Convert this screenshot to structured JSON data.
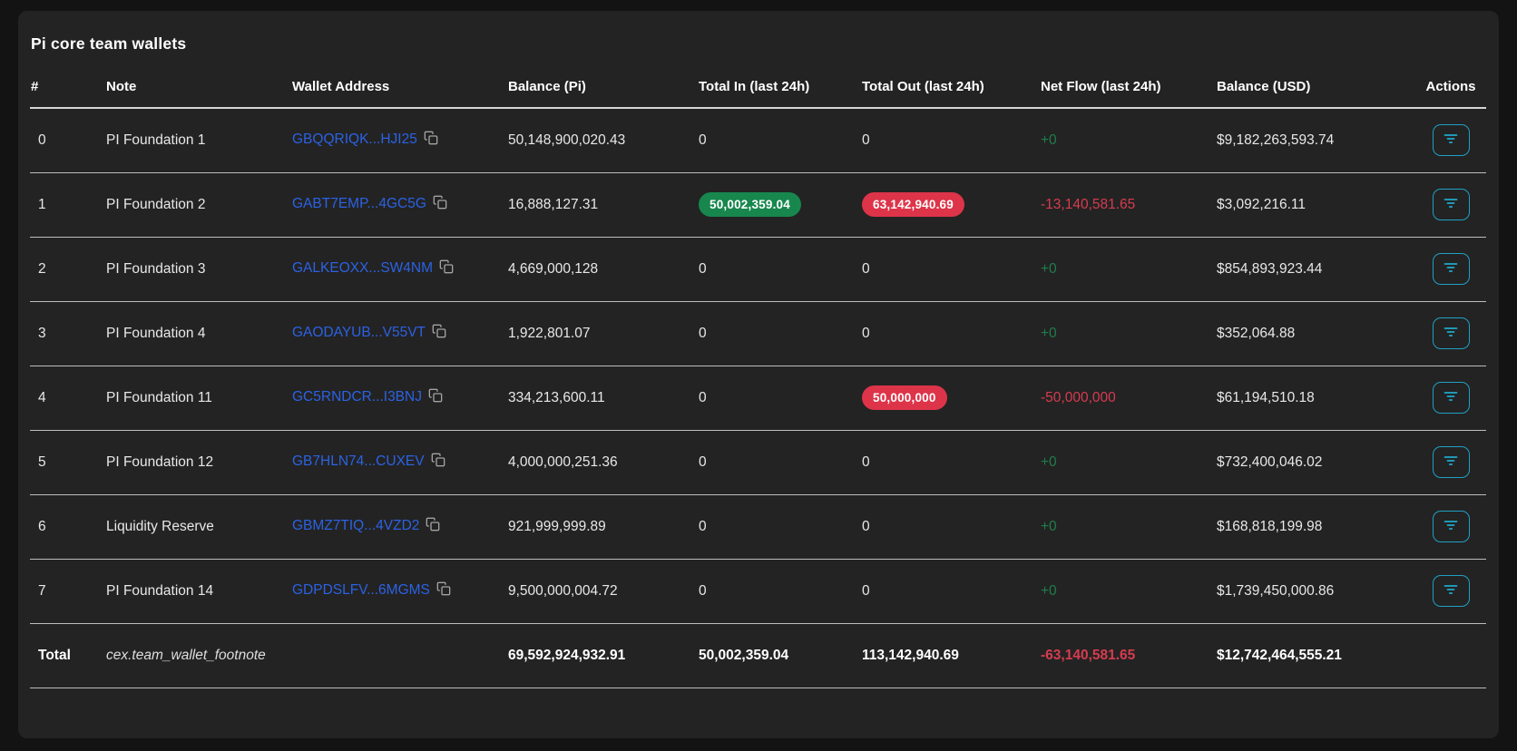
{
  "title": "Pi core team wallets",
  "columns": {
    "num": "#",
    "note": "Note",
    "wallet": "Wallet Address",
    "balance_pi": "Balance (Pi)",
    "total_in": "Total In (last 24h)",
    "total_out": "Total Out (last 24h)",
    "net_flow": "Net Flow (last 24h)",
    "balance_usd": "Balance (USD)",
    "actions": "Actions"
  },
  "rows": [
    {
      "num": "0",
      "note": "PI Foundation 1",
      "wallet": "GBQQRIQK...HJI25",
      "balance_pi": "50,148,900,020.43",
      "total_in": "0",
      "total_out": "0",
      "net_flow": "+0",
      "balance_usd": "$9,182,263,593.74"
    },
    {
      "num": "1",
      "note": "PI Foundation 2",
      "wallet": "GABT7EMP...4GC5G",
      "balance_pi": "16,888,127.31",
      "total_in": "50,002,359.04",
      "total_out": "63,142,940.69",
      "net_flow": "-13,140,581.65",
      "balance_usd": "$3,092,216.11"
    },
    {
      "num": "2",
      "note": "PI Foundation 3",
      "wallet": "GALKEOXX...SW4NM",
      "balance_pi": "4,669,000,128",
      "total_in": "0",
      "total_out": "0",
      "net_flow": "+0",
      "balance_usd": "$854,893,923.44"
    },
    {
      "num": "3",
      "note": "PI Foundation 4",
      "wallet": "GAODAYUB...V55VT",
      "balance_pi": "1,922,801.07",
      "total_in": "0",
      "total_out": "0",
      "net_flow": "+0",
      "balance_usd": "$352,064.88"
    },
    {
      "num": "4",
      "note": "PI Foundation 11",
      "wallet": "GC5RNDCR...I3BNJ",
      "balance_pi": "334,213,600.11",
      "total_in": "0",
      "total_out": "50,000,000",
      "net_flow": "-50,000,000",
      "balance_usd": "$61,194,510.18"
    },
    {
      "num": "5",
      "note": "PI Foundation 12",
      "wallet": "GB7HLN74...CUXEV",
      "balance_pi": "4,000,000,251.36",
      "total_in": "0",
      "total_out": "0",
      "net_flow": "+0",
      "balance_usd": "$732,400,046.02"
    },
    {
      "num": "6",
      "note": "Liquidity Reserve",
      "wallet": "GBMZ7TIQ...4VZD2",
      "balance_pi": "921,999,999.89",
      "total_in": "0",
      "total_out": "0",
      "net_flow": "+0",
      "balance_usd": "$168,818,199.98"
    },
    {
      "num": "7",
      "note": "PI Foundation 14",
      "wallet": "GDPDSLFV...6MGMS",
      "balance_pi": "9,500,000,004.72",
      "total_in": "0",
      "total_out": "0",
      "net_flow": "+0",
      "balance_usd": "$1,739,450,000.86"
    }
  ],
  "total": {
    "label": "Total",
    "footnote": "cex.team_wallet_footnote",
    "balance_pi": "69,592,924,932.91",
    "total_in": "50,002,359.04",
    "total_out": "113,142,940.69",
    "net_flow": "-63,140,581.65",
    "balance_usd": "$12,742,464,555.21"
  },
  "icons": {
    "actions_button": "filter-icon",
    "wallet_copy": "copy-icon"
  },
  "colors": {
    "card_bg": "#232323",
    "page_bg": "#131313",
    "accent_cyan": "#1fa0c4",
    "link_blue": "#2b62e4",
    "badge_green": "#17874e",
    "badge_red": "#dd3449",
    "net_positive": "#1f7e4b",
    "net_negative": "#d63c50",
    "row_divider": "#bdbdbd"
  }
}
